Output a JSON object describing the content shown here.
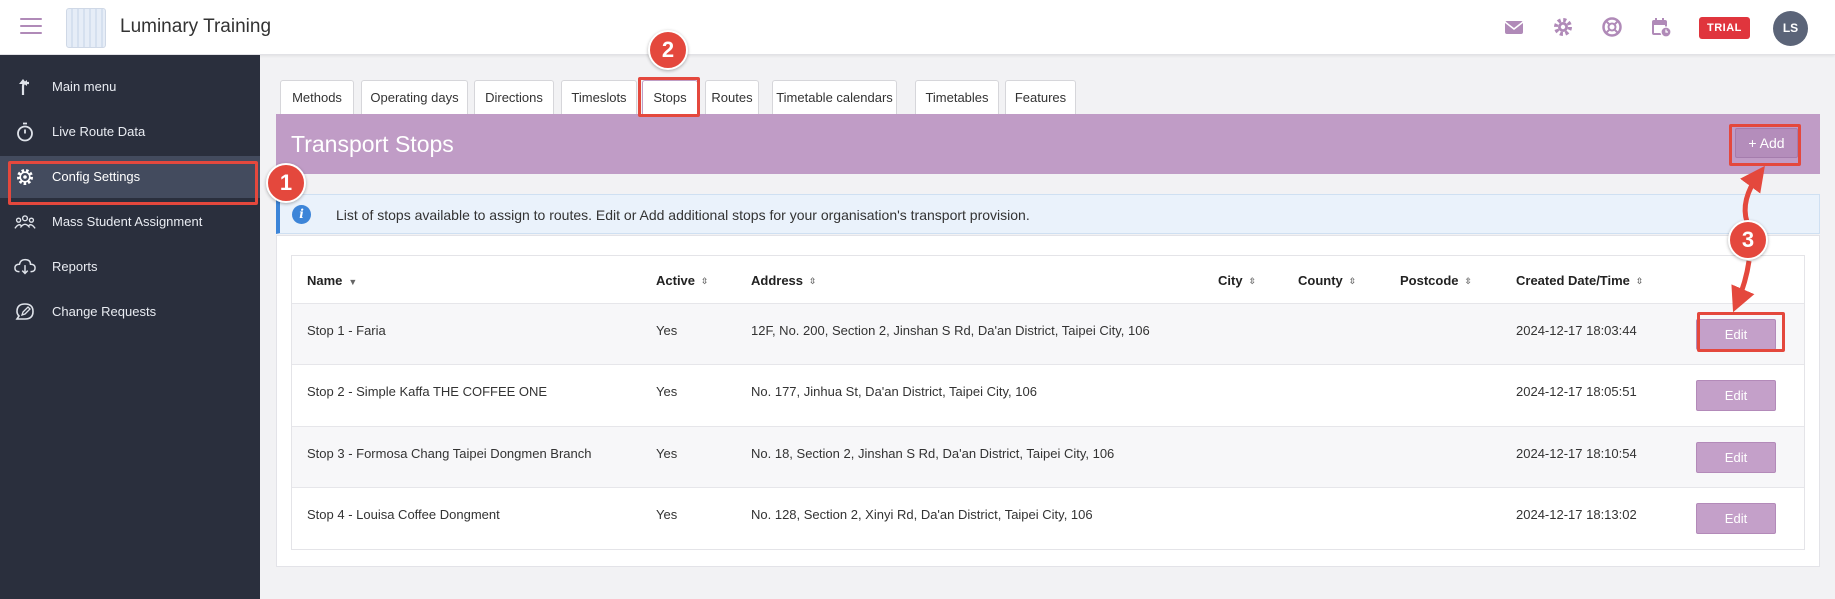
{
  "app": {
    "title": "Luminary Training",
    "trial_label": "TRIAL",
    "user_initials": "LS"
  },
  "header_icons": [
    "mail-icon",
    "gear-icon",
    "lifebuoy-icon",
    "calendar-icon"
  ],
  "sidebar": {
    "items": [
      {
        "label": "Main menu",
        "icon": "arrow-up-icon"
      },
      {
        "label": "Live Route Data",
        "icon": "stopwatch-icon"
      },
      {
        "label": "Config Settings",
        "icon": "gear-icon",
        "active": true
      },
      {
        "label": "Mass Student Assignment",
        "icon": "group-icon"
      },
      {
        "label": "Reports",
        "icon": "cloud-download-icon"
      },
      {
        "label": "Change Requests",
        "icon": "edit-bubble-icon"
      }
    ]
  },
  "tabs": [
    "Methods",
    "Operating days",
    "Directions",
    "Timeslots",
    "Stops",
    "Routes",
    "Timetable calendars",
    "Timetables",
    "Features"
  ],
  "active_tab": "Stops",
  "page": {
    "title": "Transport Stops",
    "add_label": "+ Add",
    "info": "List of stops available to assign to routes. Edit or Add additional stops for your organisation's transport provision."
  },
  "table": {
    "columns": [
      "Name",
      "Active",
      "Address",
      "City",
      "County",
      "Postcode",
      "Created Date/Time"
    ],
    "edit_label": "Edit",
    "rows": [
      {
        "name": "Stop 1 - Faria",
        "active": "Yes",
        "address": "12F, No. 200, Section 2, Jinshan S Rd, Da'an District, Taipei City, 106",
        "city": "",
        "county": "",
        "postcode": "",
        "created": "2024-12-17 18:03:44"
      },
      {
        "name": "Stop 2 - Simple Kaffa THE COFFEE ONE",
        "active": "Yes",
        "address": "No. 177, Jinhua St, Da'an District, Taipei City, 106",
        "city": "",
        "county": "",
        "postcode": "",
        "created": "2024-12-17 18:05:51"
      },
      {
        "name": "Stop 3 - Formosa Chang Taipei Dongmen Branch",
        "active": "Yes",
        "address": "No. 18, Section 2, Jinshan S Rd, Da'an District, Taipei City, 106",
        "city": "",
        "county": "",
        "postcode": "",
        "created": "2024-12-17 18:10:54"
      },
      {
        "name": "Stop 4 - Louisa Coffee Dongment",
        "active": "Yes",
        "address": "No. 128, Section 2, Xinyi Rd, Da'an District, Taipei City, 106",
        "city": "",
        "county": "",
        "postcode": "",
        "created": "2024-12-17 18:13:02"
      }
    ]
  },
  "annotations": [
    "1",
    "2",
    "3"
  ],
  "colors": {
    "accent": "#c09cc6",
    "sidebar": "#2a2f3d",
    "annotation": "#e4483d",
    "trial": "#e0353d",
    "info": "#3d85d8"
  }
}
